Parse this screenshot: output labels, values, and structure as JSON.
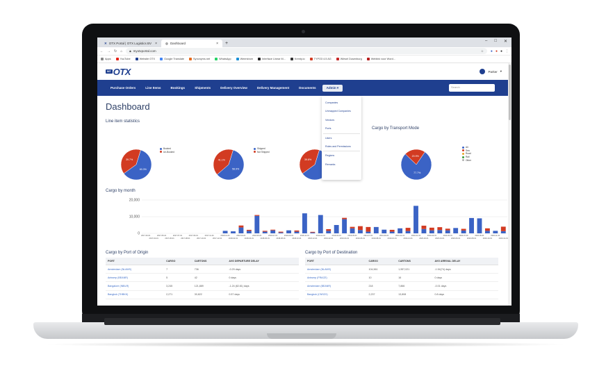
{
  "browser": {
    "tabs": [
      {
        "label": "OTX Portal | OTX Logistics BV",
        "icon": "otx-icon"
      },
      {
        "label": "Dashboard",
        "icon": "globe-icon"
      }
    ],
    "new_tab": "+",
    "window_controls": [
      "–",
      "□",
      "✕"
    ],
    "url": "myotxportal.com",
    "bookmarks": [
      "Apps",
      "YouTube",
      "Website OTX",
      "Google Translate",
      "Synonyms.net",
      "WhatsApp",
      "Weerstrom",
      "Interface Linear M...",
      "Krenty.io",
      "TYPO3 4.5 AG",
      "Wiesel Dusenburg",
      "Weblink voor Word..."
    ]
  },
  "header": {
    "logo_tag": "INT",
    "logo_text": "OTX",
    "user_name": "Parker"
  },
  "nav": {
    "items": [
      "Purchase Orders",
      "Line Items",
      "Bookings",
      "Shipments",
      "Delivery Overview",
      "Delivery Management",
      "Documents"
    ],
    "admin_label": "Admin ▾",
    "search_placeholder": "Search"
  },
  "admin_menu": {
    "groups": [
      [
        "Companies",
        "Unmapped Companies",
        "Vendors",
        "Ports"
      ],
      [
        "Users",
        "Roles and Permissions"
      ],
      [
        "Regions",
        "Remarks"
      ]
    ]
  },
  "page": {
    "title": "Dashboard",
    "line_item_title": "Line item statistics",
    "cargo_mode_title": "Cargo by Transport Mode",
    "cargo_month_title": "Cargo by month",
    "origin_title": "Cargo by Port of Origin",
    "destination_title": "Cargo by Port of Destination"
  },
  "pies": [
    {
      "legend": [
        "Booked",
        "Un-Booked"
      ],
      "colors": [
        "#3b63c5",
        "#d23b22"
      ],
      "values": [
        60.3,
        39.7
      ],
      "labels": [
        "60.3%",
        "39.7%"
      ]
    },
    {
      "legend": [
        "Shipped",
        "Not Shipped"
      ],
      "colors": [
        "#3b63c5",
        "#d23b22"
      ],
      "values": [
        58.9,
        41.1
      ],
      "labels": [
        "58.9%",
        "41.1%"
      ]
    },
    {
      "legend": [],
      "colors": [
        "#3b63c5",
        "#d23b22"
      ],
      "values": [
        60.2,
        39.8
      ],
      "labels": [
        "",
        "39.8%"
      ]
    },
    {
      "legend": [
        "Air",
        "Sea",
        "Road",
        "Rail",
        "Other"
      ],
      "colors": [
        "#3b63c5",
        "#d23b22",
        "#e9a429",
        "#3a9a3a",
        "#b0b0b0"
      ],
      "values": [
        77.7,
        22.3,
        0,
        0,
        0
      ],
      "labels": [
        "77.7%",
        "20.9%"
      ]
    }
  ],
  "chart_data": {
    "type": "bar",
    "title": "Cargo by month",
    "ylim": [
      0,
      20000
    ],
    "yticks": [
      "20,000",
      "10,000",
      "0"
    ],
    "categories": [
      "2017-03-01",
      "2017-04-01",
      "2017-05-01",
      "2017-06-01",
      "2017-07-01",
      "2017-08-01",
      "2017-09-01",
      "2017-10-01",
      "2017-11-01",
      "2017-12-01",
      "2018-01-01",
      "2018-02-01",
      "2018-03-01",
      "2018-04-01",
      "2018-05-01",
      "2018-06-01",
      "2018-07-01",
      "2018-08-01",
      "2018-09-01",
      "2018-10-01",
      "2018-11-01",
      "2018-12-01",
      "2019-01-01",
      "2019-02-01",
      "2019-03-01",
      "2019-04-01",
      "2019-05-01",
      "2019-06-01",
      "2019-07-01",
      "2019-08-01",
      "2019-09-01",
      "2019-10-01",
      "2019-11-01",
      "2019-12-01",
      "2020-01-01",
      "2020-02-01",
      "2020-03-01",
      "2020-04-01",
      "2020-05-01",
      "2020-06-01",
      "2020-07-01",
      "2020-08-01",
      "2020-09-01",
      "2020-10-01",
      "2020-11-01",
      "2020-12-01"
    ],
    "series": [
      {
        "name": "Air",
        "color": "#3b63c5",
        "values": [
          0,
          0,
          0,
          0,
          0,
          0,
          0,
          0,
          0,
          0,
          1500,
          1200,
          3500,
          1500,
          10500,
          1000,
          1800,
          500,
          1800,
          1000,
          12000,
          500,
          11000,
          1500,
          5000,
          8500,
          3000,
          2000,
          1000,
          3800,
          2200,
          1000,
          3000,
          1400,
          16500,
          2600,
          1800,
          2000,
          1800,
          3200,
          1700,
          9200,
          9000,
          1500,
          1500,
          1300
        ]
      },
      {
        "name": "Sea",
        "color": "#d23b22",
        "values": [
          0,
          0,
          0,
          0,
          0,
          0,
          0,
          0,
          0,
          0,
          0,
          0,
          1200,
          600,
          500,
          500,
          400,
          500,
          0,
          700,
          0,
          400,
          0,
          1000,
          0,
          800,
          900,
          2300,
          2800,
          0,
          0,
          1100,
          0,
          1900,
          0,
          2000,
          1600,
          1700,
          1000,
          0,
          1000,
          0,
          0,
          1500,
          0,
          2700
        ]
      }
    ]
  },
  "origin_table": {
    "columns": [
      "PORT",
      "CARGO",
      "CARTONS",
      "AVG DEPARTURE DELAY"
    ],
    "rows": [
      [
        "Amsterdam (NLAMS)",
        "7",
        "736",
        "-0.29 days"
      ],
      [
        "Antwerp (BEANR)",
        "5",
        "42",
        "0 days"
      ],
      [
        "Bangalore (INBLR)",
        "3,245",
        "121,889",
        "-1.24 (82.81) days"
      ],
      [
        "Bangkok (THBKK)",
        "2,271",
        "30,822",
        "0.57 days"
      ]
    ]
  },
  "destination_table": {
    "columns": [
      "PORT",
      "CARGO",
      "CARTONS",
      "AVG ARRIVAL DELAY"
    ],
    "rows": [
      [
        "Amsterdam (NLAMS)",
        "104,561",
        "1,957,021",
        "-1.54(74) days"
      ],
      [
        "Antwerp (FRACE)",
        "10",
        "16",
        "0 days"
      ],
      [
        "Amsterdam (BEANR)",
        "218",
        "7,866",
        "-0.01 days"
      ],
      [
        "Bangkok (CNSZX)",
        "2,237",
        "13,808",
        "0.8 days"
      ]
    ]
  }
}
